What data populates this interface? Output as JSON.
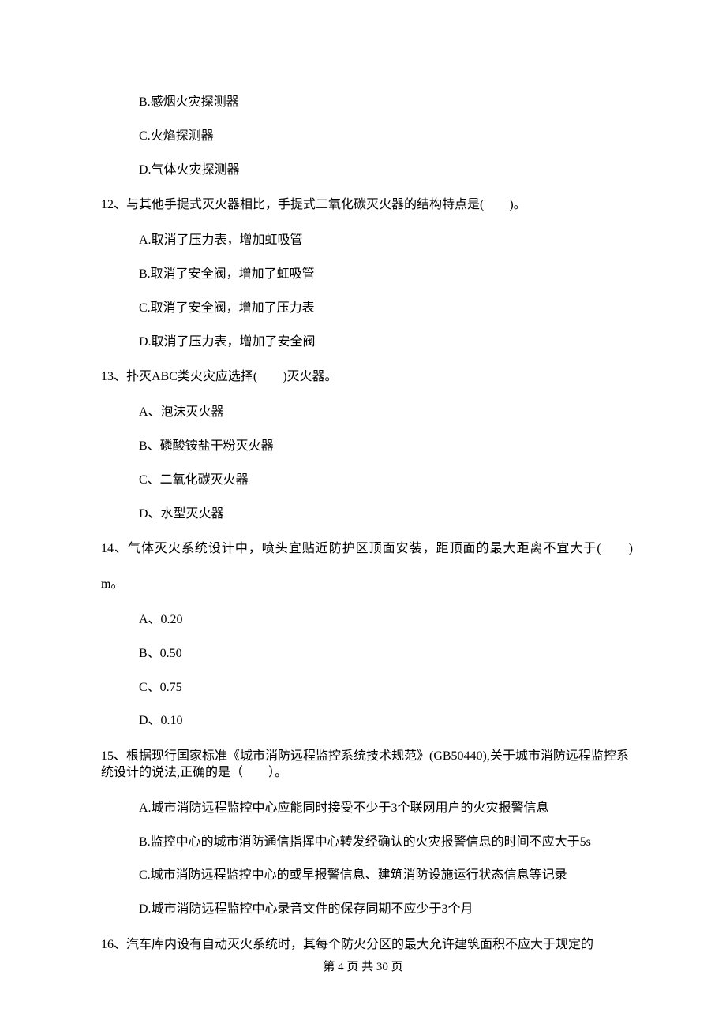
{
  "q11": {
    "options": {
      "b": "B.感烟火灾探测器",
      "c": "C.火焰探测器",
      "d": "D.气体火灾探测器"
    }
  },
  "q12": {
    "text": "12、与其他手提式灭火器相比，手提式二氧化碳灭火器的结构特点是(　　)。",
    "options": {
      "a": "A.取消了压力表，增加虹吸管",
      "b": "B.取消了安全阀，增加了虹吸管",
      "c": "C.取消了安全阀，增加了压力表",
      "d": "D.取消了压力表，增加了安全阀"
    }
  },
  "q13": {
    "text": "13、扑灭ABC类火灾应选择(　　)灭火器。",
    "options": {
      "a": "A、泡沫灭火器",
      "b": "B、磷酸铵盐干粉灭火器",
      "c": "C、二氧化碳灭火器",
      "d": "D、水型灭火器"
    }
  },
  "q14": {
    "line1": "14、气体灭火系统设计中，喷头宜贴近防护区顶面安装，距顶面的最大距离不宜大于(　　)",
    "line2": "m。",
    "options": {
      "a": "A、0.20",
      "b": "B、0.50",
      "c": "C、0.75",
      "d": "D、0.10"
    }
  },
  "q15": {
    "text": "15、根据现行国家标准《城市消防远程监控系统技术规范》(GB50440),关于城市消防远程监控系统设计的说法,正确的是（　　）。",
    "options": {
      "a": "A.城市消防远程监控中心应能同时接受不少于3个联网用户的火灾报警信息",
      "b": "B.监控中心的城市消防通信指挥中心转发经确认的火灾报警信息的时间不应大于5s",
      "c": "C.城市消防远程监控中心的或早报警信息、建筑消防设施运行状态信息等记录",
      "d": "D.城市消防远程监控中心录音文件的保存同期不应少于3个月"
    }
  },
  "q16": {
    "text": "16、汽车库内设有自动灭火系统时，其每个防火分区的最大允许建筑面积不应大于规定的"
  },
  "footer": "第 4 页 共 30 页"
}
